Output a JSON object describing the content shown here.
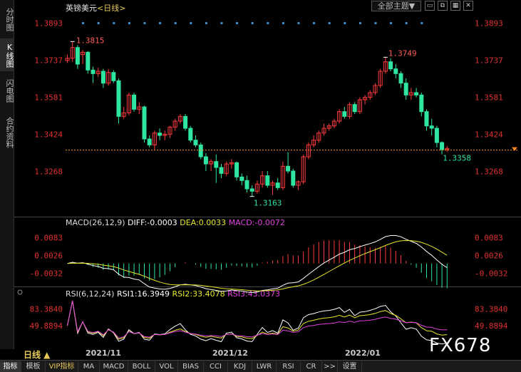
{
  "sidebar": {
    "tabs": [
      {
        "label": "分时图",
        "active": false
      },
      {
        "label": "K线图",
        "active": true
      },
      {
        "label": "闪电图",
        "active": false
      },
      {
        "label": "合约资料",
        "active": false
      }
    ]
  },
  "header": {
    "instrument": "英镑美元",
    "period": "<日线>",
    "theme_button": "全部主题▼",
    "icons": [
      "window-icon",
      "restore-icon",
      "grid-icon"
    ]
  },
  "colors": {
    "up": "#ff3b3b",
    "down": "#2ee6a0",
    "diff": "#ffffff",
    "dea": "#e6e62e",
    "macd": "#e040e0",
    "rsi1": "#ffffff",
    "rsi2": "#e6e62e",
    "rsi3": "#e040e0",
    "marker": "#3a8fd0",
    "last_price_line": "#ff8c1a"
  },
  "chart_data": [
    {
      "type": "candlestick",
      "title": "英镑美元<日线>",
      "y_ticks": [
        "1.3893",
        "1.3737",
        "1.3581",
        "1.3424",
        "1.3268"
      ],
      "ylim": [
        1.309,
        1.393
      ],
      "annotations": {
        "high": "1.3815",
        "high2": "1.3749",
        "low": "1.3163",
        "last": "1.3358"
      },
      "last_price": 1.3358,
      "x_labels": [
        "2021/11",
        "2021/12",
        "2022/01"
      ],
      "candles": [
        [
          1.3735,
          1.376,
          1.3725,
          1.3745
        ],
        [
          1.3745,
          1.3815,
          1.373,
          1.379
        ],
        [
          1.379,
          1.38,
          1.37,
          1.372
        ],
        [
          1.376,
          1.378,
          1.372,
          1.377
        ],
        [
          1.377,
          1.3775,
          1.368,
          1.3695
        ],
        [
          1.3695,
          1.371,
          1.364,
          1.368
        ],
        [
          1.368,
          1.3705,
          1.3665,
          1.369
        ],
        [
          1.369,
          1.37,
          1.362,
          1.364
        ],
        [
          1.364,
          1.37,
          1.363,
          1.3685
        ],
        [
          1.3685,
          1.3695,
          1.364,
          1.365
        ],
        [
          1.365,
          1.366,
          1.347,
          1.35
        ],
        [
          1.35,
          1.354,
          1.349,
          1.3515
        ],
        [
          1.3515,
          1.36,
          1.3505,
          1.359
        ],
        [
          1.359,
          1.36,
          1.352,
          1.353
        ],
        [
          1.353,
          1.356,
          1.351,
          1.354
        ],
        [
          1.354,
          1.3545,
          1.339,
          1.3405
        ],
        [
          1.3405,
          1.342,
          1.337,
          1.338
        ],
        [
          1.338,
          1.344,
          1.336,
          1.343
        ],
        [
          1.343,
          1.345,
          1.34,
          1.342
        ],
        [
          1.342,
          1.344,
          1.34,
          1.3425
        ],
        [
          1.3425,
          1.346,
          1.341,
          1.3455
        ],
        [
          1.3455,
          1.349,
          1.344,
          1.348
        ],
        [
          1.348,
          1.351,
          1.347,
          1.35
        ],
        [
          1.35,
          1.351,
          1.344,
          1.345
        ],
        [
          1.345,
          1.346,
          1.339,
          1.34
        ],
        [
          1.34,
          1.342,
          1.337,
          1.338
        ],
        [
          1.338,
          1.339,
          1.332,
          1.333
        ],
        [
          1.333,
          1.3345,
          1.327,
          1.33
        ],
        [
          1.33,
          1.332,
          1.327,
          1.331
        ],
        [
          1.331,
          1.334,
          1.322,
          1.3285
        ],
        [
          1.3285,
          1.33,
          1.324,
          1.326
        ],
        [
          1.326,
          1.331,
          1.325,
          1.33
        ],
        [
          1.33,
          1.332,
          1.328,
          1.3305
        ],
        [
          1.3305,
          1.331,
          1.323,
          1.3245
        ],
        [
          1.3245,
          1.326,
          1.321,
          1.323
        ],
        [
          1.323,
          1.325,
          1.318,
          1.3195
        ],
        [
          1.3195,
          1.321,
          1.3163,
          1.3185
        ],
        [
          1.3185,
          1.323,
          1.3175,
          1.3215
        ],
        [
          1.3215,
          1.327,
          1.32,
          1.325
        ],
        [
          1.325,
          1.327,
          1.32,
          1.321
        ],
        [
          1.321,
          1.323,
          1.317,
          1.322
        ],
        [
          1.322,
          1.324,
          1.319,
          1.32
        ],
        [
          1.32,
          1.331,
          1.319,
          1.329
        ],
        [
          1.329,
          1.335,
          1.326,
          1.327
        ],
        [
          1.327,
          1.328,
          1.32,
          1.321
        ],
        [
          1.321,
          1.323,
          1.319,
          1.3225
        ],
        [
          1.3225,
          1.334,
          1.3215,
          1.333
        ],
        [
          1.333,
          1.339,
          1.332,
          1.338
        ],
        [
          1.338,
          1.342,
          1.337,
          1.34
        ],
        [
          1.34,
          1.344,
          1.339,
          1.343
        ],
        [
          1.343,
          1.347,
          1.342,
          1.345
        ],
        [
          1.345,
          1.347,
          1.344,
          1.346
        ],
        [
          1.346,
          1.349,
          1.345,
          1.348
        ],
        [
          1.348,
          1.353,
          1.347,
          1.352
        ],
        [
          1.352,
          1.354,
          1.349,
          1.35
        ],
        [
          1.35,
          1.356,
          1.349,
          1.355
        ],
        [
          1.355,
          1.356,
          1.351,
          1.352
        ],
        [
          1.352,
          1.358,
          1.351,
          1.357
        ],
        [
          1.357,
          1.359,
          1.355,
          1.358
        ],
        [
          1.358,
          1.361,
          1.357,
          1.36
        ],
        [
          1.36,
          1.364,
          1.359,
          1.363
        ],
        [
          1.363,
          1.37,
          1.362,
          1.369
        ],
        [
          1.369,
          1.3749,
          1.368,
          1.373
        ],
        [
          1.373,
          1.3745,
          1.369,
          1.37
        ],
        [
          1.37,
          1.372,
          1.366,
          1.368
        ],
        [
          1.368,
          1.369,
          1.362,
          1.364
        ],
        [
          1.364,
          1.366,
          1.357,
          1.359
        ],
        [
          1.359,
          1.362,
          1.357,
          1.36
        ],
        [
          1.36,
          1.362,
          1.358,
          1.359
        ],
        [
          1.359,
          1.36,
          1.35,
          1.352
        ],
        [
          1.352,
          1.353,
          1.344,
          1.346
        ],
        [
          1.346,
          1.349,
          1.342,
          1.345
        ],
        [
          1.345,
          1.346,
          1.337,
          1.339
        ],
        [
          1.339,
          1.3395,
          1.334,
          1.336
        ],
        [
          1.336,
          1.3375,
          1.335,
          1.3365
        ]
      ]
    },
    {
      "type": "macd",
      "title": "MACD(26,12,9)",
      "legend": {
        "diff": "DIFF:-0.0003",
        "dea": "DEA:0.0033",
        "macd": "MACD:-0.0072"
      },
      "y_ticks": [
        "0.0083",
        "0.0026",
        "-0.0032"
      ],
      "ylim": [
        -0.007,
        0.011
      ]
    },
    {
      "type": "rsi",
      "title": "RSI(6,12,24)",
      "legend": {
        "rsi1": "RSI1:16.3949",
        "rsi2": "RSI2:33.4078",
        "rsi3": "RSI3:43.0373"
      },
      "y_ticks": [
        "83.3840",
        "49.8894"
      ],
      "ylim": [
        10,
        100
      ]
    }
  ],
  "date_axis": {
    "period_label": "日线 ▲"
  },
  "bottom_tabs": [
    {
      "label": "指标",
      "active": true
    },
    {
      "label": "模板",
      "active": false
    },
    {
      "label": "VIP指标",
      "active": false
    },
    {
      "label": "MA",
      "active": false
    },
    {
      "label": "MACD",
      "active": false
    },
    {
      "label": "BOLL",
      "active": false
    },
    {
      "label": "VOL",
      "active": false
    },
    {
      "label": "BIAS",
      "active": false
    },
    {
      "label": "CCI",
      "active": false
    },
    {
      "label": "KDJ",
      "active": false
    },
    {
      "label": "LWR",
      "active": false
    },
    {
      "label": "RSI",
      "active": false
    },
    {
      "label": "CR",
      "active": false
    },
    {
      "label": ">>",
      "active": false
    },
    {
      "label": "设置",
      "active": false
    }
  ],
  "watermark": "FX678"
}
